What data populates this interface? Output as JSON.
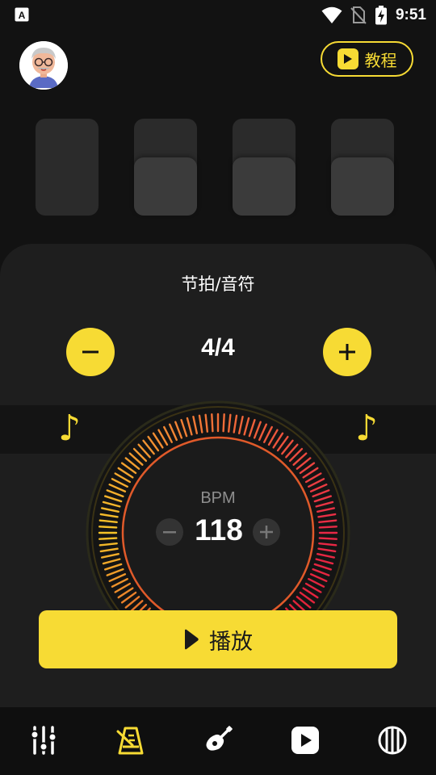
{
  "status_bar": {
    "time": "9:51",
    "icons": [
      "app-notification-icon",
      "wifi-icon",
      "no-sim-icon",
      "battery-charging-icon"
    ]
  },
  "header": {
    "avatar_icon": "avatar",
    "tutorial_label": "教程",
    "tutorial_icon": "play-square-icon"
  },
  "beats": [
    {
      "index": 1,
      "accent": true
    },
    {
      "index": 2,
      "accent": false
    },
    {
      "index": 3,
      "accent": false
    },
    {
      "index": 4,
      "accent": false
    }
  ],
  "meter": {
    "title": "节拍/音符",
    "value": "4/4",
    "decrease_icon": "minus-icon",
    "increase_icon": "plus-icon",
    "note_glyph": "♪"
  },
  "tempo": {
    "label": "BPM",
    "value": "118",
    "decrease_icon": "minus-icon",
    "increase_icon": "plus-icon"
  },
  "play_button": {
    "label": "播放",
    "icon": "play-icon"
  },
  "bottom_nav": [
    {
      "icon": "mixer-sliders-icon",
      "active": false
    },
    {
      "icon": "metronome-icon",
      "active": true
    },
    {
      "icon": "guitar-icon",
      "active": false
    },
    {
      "icon": "video-play-icon",
      "active": false
    },
    {
      "icon": "strings-tuner-icon",
      "active": false
    }
  ],
  "colors": {
    "accent": "#F7DB34",
    "background": "#121212",
    "panel": "#1E1E1E"
  }
}
